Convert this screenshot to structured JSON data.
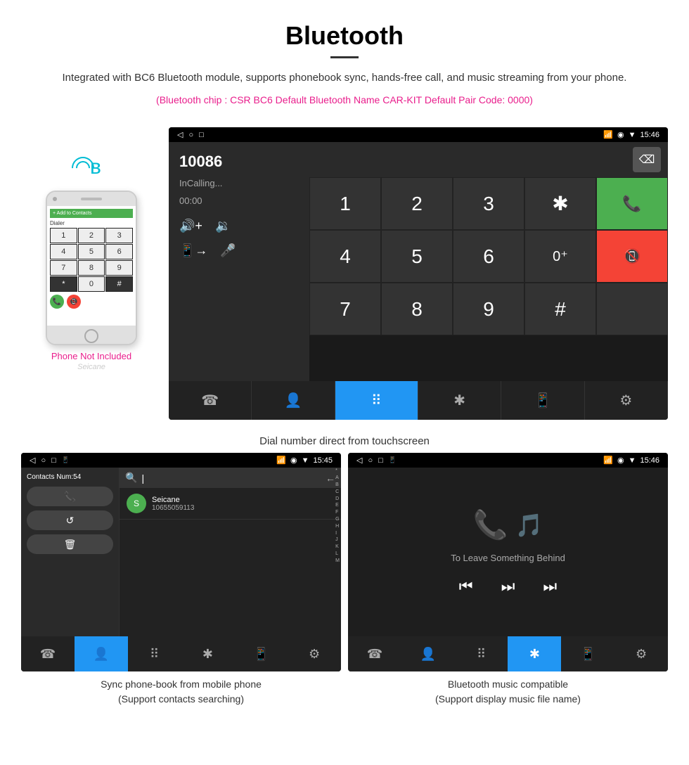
{
  "header": {
    "title": "Bluetooth",
    "description": "Integrated with BC6 Bluetooth module, supports phonebook sync, hands-free call, and music streaming from your phone.",
    "specs": "(Bluetooth chip : CSR BC6    Default Bluetooth Name CAR-KIT    Default Pair Code: 0000)"
  },
  "main_screen": {
    "status_bar": {
      "left_icons": [
        "◁",
        "○",
        "□"
      ],
      "right_icons": [
        "📱",
        "⚡"
      ],
      "time": "15:46"
    },
    "dialer": {
      "number": "10086",
      "status": "InCalling...",
      "timer": "00:00"
    },
    "caption": "Dial number direct from touchscreen"
  },
  "phone_mock": {
    "contacts_label": "Add to Contacts",
    "keys": [
      "1",
      "2",
      "3",
      "4",
      "5",
      "6",
      "7",
      "8",
      "9",
      "*",
      "0",
      "#"
    ]
  },
  "phone_not_included": "Phone Not Included",
  "seicane": "Seicane",
  "bottom_screens": {
    "contacts": {
      "caption_line1": "Sync phone-book from mobile phone",
      "caption_line2": "(Support contacts searching)",
      "contacts_num": "Contacts Num:54",
      "contact_name": "Seicane",
      "contact_number": "10655059113",
      "search_placeholder": "|",
      "time": "15:45"
    },
    "music": {
      "caption_line1": "Bluetooth music compatible",
      "caption_line2": "(Support display music file name)",
      "song_title": "To Leave Something Behind",
      "time": "15:46"
    }
  },
  "keypad": {
    "keys": [
      "1",
      "2",
      "3",
      "★",
      "",
      "4",
      "5",
      "6",
      "0+",
      "",
      "7",
      "8",
      "9",
      "#",
      ""
    ]
  },
  "nav_icons": {
    "phone": "☎",
    "contacts": "👤",
    "keypad": "⠿",
    "bluetooth": "✱",
    "phone_out": "📱",
    "settings": "⚙"
  }
}
